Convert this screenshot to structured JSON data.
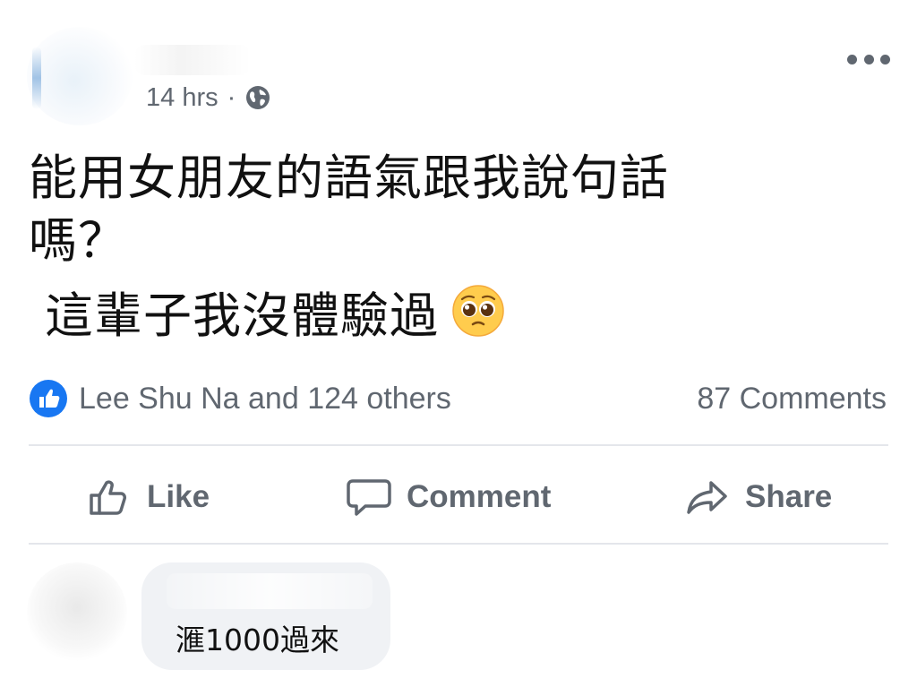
{
  "post": {
    "time": "14 hrs",
    "separator": "·",
    "audience_icon": "globe-icon",
    "menu_icon": "more-icon",
    "text_line1": "能用女朋友的語氣跟我說句話",
    "text_line2": "嗎？",
    "text_line3": "這輩子我沒體驗過",
    "emoji": "pleading-face-icon"
  },
  "reactions": {
    "summary": "Lee Shu Na and 124 others",
    "comments": "87 Comments",
    "like_color": "#1877f2"
  },
  "actions": {
    "like": "Like",
    "comment": "Comment",
    "share": "Share"
  },
  "comment": {
    "text": "滙1000過來"
  }
}
